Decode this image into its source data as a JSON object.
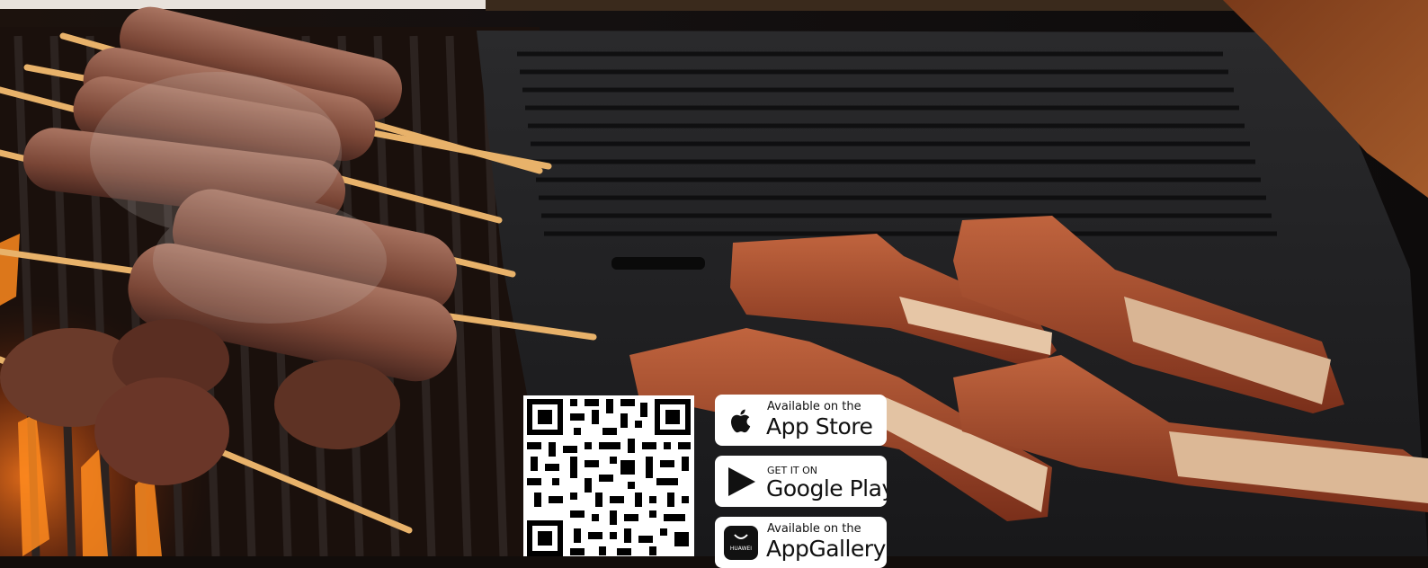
{
  "background": {
    "scene": "grilled kebabs and lamb chops on a barbecue grill",
    "accent_color": "#b8583a"
  },
  "qr_code": {
    "icon": "qr-code-icon"
  },
  "badges": {
    "app_store": {
      "small": "Available on the",
      "big": "App Store",
      "icon": "apple-icon"
    },
    "google_play": {
      "small": "GET IT ON",
      "big": "Google Play",
      "icon": "play-icon"
    },
    "app_gallery": {
      "small": "Available on the",
      "big": "AppGallery",
      "icon": "huawei-icon",
      "icon_label": "HUAWEI"
    }
  }
}
